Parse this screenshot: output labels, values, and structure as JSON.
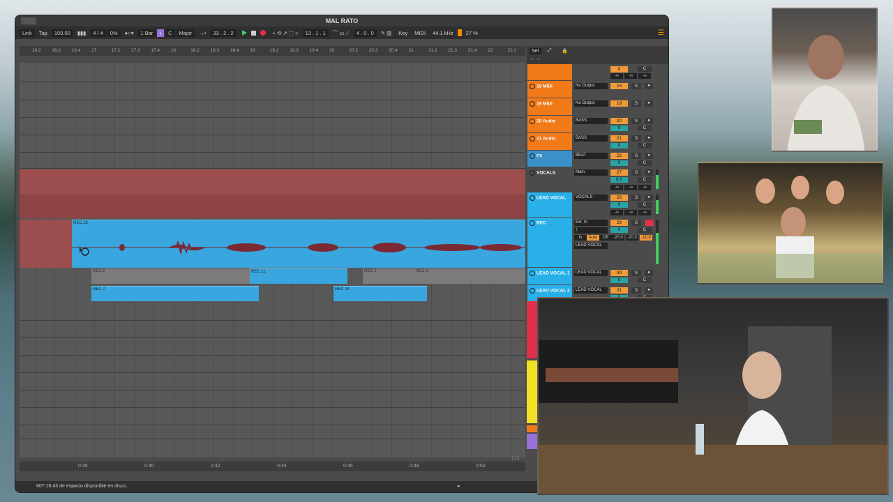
{
  "window": {
    "title": "MAL RATO"
  },
  "toolbar": {
    "link": "Link",
    "tap": "Tap",
    "tempo": "100.00",
    "meter_icon": "metronome-bars-icon",
    "signature": "4 / 4",
    "swing": "0%",
    "quantize": "1 Bar",
    "key_root": "C",
    "scale": "Major",
    "arrangement_pos": "33 .  2 .  2",
    "loop_start": "13 .  1 .  1",
    "loop_length": "4 .  0 .  0",
    "key_map": "Key",
    "midi_map": "MIDI",
    "sample_rate": "44.1 kHz",
    "cpu": "27 %",
    "accent_color": "#f08c00",
    "record_color": "#e0304a",
    "play_color": "#3fd05f"
  },
  "ruler": {
    "marks": [
      "16.2",
      "16.3",
      "16.4",
      "17",
      "17.2",
      "17.3",
      "17.4",
      "18",
      "18.2",
      "18.3",
      "18.4",
      "19",
      "19.2",
      "19.3",
      "19.4",
      "20",
      "20.2",
      "20.3",
      "20.4",
      "21",
      "21.2",
      "21.3",
      "21.4",
      "22",
      "22.2"
    ]
  },
  "timeline": {
    "marks": [
      "0:38",
      "0:40",
      "0:42",
      "0:44",
      "0:46",
      "0:48",
      "0:50"
    ],
    "page": "1/4"
  },
  "clips": {
    "rec22": "REC 22",
    "rec5a": "REC 5",
    "rec11": "REC 11",
    "rec5b": "REC 5",
    "rec6": "REC 6",
    "rec7": "REC 7",
    "rec14": "REC 14"
  },
  "mixer": {
    "set_label": "Set",
    "tracks": [
      {
        "name": "",
        "output": "",
        "num": "0",
        "extra": "C",
        "inf": [
          "-∞",
          "-∞",
          "-∞"
        ],
        "color": "#f07a1a"
      },
      {
        "name": "18 MIDI",
        "output": "No Output",
        "num": "18",
        "s": "S",
        "color": "#f07a1a"
      },
      {
        "name": "19 MIDI",
        "output": "No Output",
        "num": "19",
        "s": "S",
        "color": "#f07a1a"
      },
      {
        "name": "20 Audio",
        "output": "BASS",
        "num": "20",
        "val": "0",
        "s": "S",
        "c": "C",
        "color": "#f07a1a"
      },
      {
        "name": "21 Audio",
        "output": "BASS",
        "num": "21",
        "val": "0",
        "s": "S",
        "c": "C",
        "color": "#f07a1a"
      },
      {
        "name": "FX",
        "output": "BEAT",
        "num": "22",
        "val": "0",
        "s": "S",
        "c": "C",
        "color": "#3a90c8"
      },
      {
        "name": "VOCALS",
        "output": "Main",
        "num": "27",
        "val": "6.0",
        "s": "S",
        "c": "C",
        "inf": [
          "-∞",
          "-∞",
          "-∞"
        ],
        "color": "#4b4b4b"
      },
      {
        "name": "LEAD VOCAL",
        "output": "VOCALS",
        "num": "28",
        "val": "0",
        "s": "S",
        "c": "C",
        "inf": [
          "-∞",
          "-∞",
          "-∞"
        ],
        "color": "#2ab0e8"
      },
      {
        "name": "REC",
        "input": "Ext. In",
        "channel": "1",
        "in": "In",
        "auto": "Auto",
        "off": "Off",
        "out": "LEAD VOCAL",
        "num": "29",
        "val": "0",
        "s": "S",
        "c": "C",
        "db": [
          "-20.0",
          "-20.0",
          "-10.0"
        ],
        "color": "#2ab0e8"
      },
      {
        "name": "LEAD VOCAL 1",
        "output": "LEAD VOCAL",
        "num": "30",
        "val": "0",
        "s": "S",
        "c": "C",
        "color": "#2ab0e8"
      },
      {
        "name": "LEAD VOCAL 2",
        "output": "LEAD VOCAL",
        "num": "31",
        "val": "0",
        "s": "S",
        "c": "C",
        "color": "#2ab0e8"
      }
    ]
  },
  "status": {
    "text": "607:16:43 de espacio disponible en disco."
  },
  "cams": {
    "top": "",
    "middle": "",
    "bottom": ""
  }
}
